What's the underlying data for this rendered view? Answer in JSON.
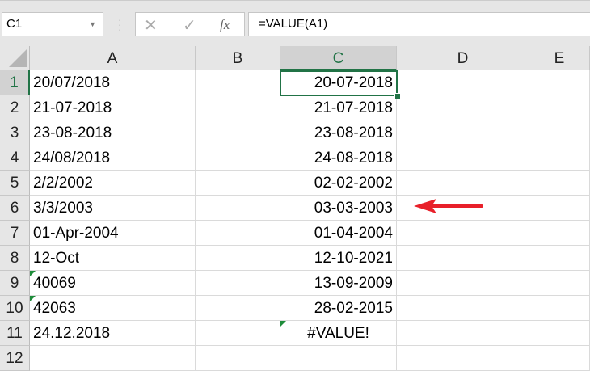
{
  "name_box": "C1",
  "formula": "=VALUE(A1)",
  "fx_label": "fx",
  "columns": [
    "A",
    "B",
    "C",
    "D",
    "E"
  ],
  "rows": [
    {
      "n": "1",
      "a": "20/07/2018",
      "c": "20-07-2018"
    },
    {
      "n": "2",
      "a": "21-07-2018",
      "c": "21-07-2018"
    },
    {
      "n": "3",
      "a": "23-08-2018",
      "c": "23-08-2018"
    },
    {
      "n": "4",
      "a": "24/08/2018",
      "c": "24-08-2018"
    },
    {
      "n": "5",
      "a": "2/2/2002",
      "c": "02-02-2002"
    },
    {
      "n": "6",
      "a": "3/3/2003",
      "c": "03-03-2003"
    },
    {
      "n": "7",
      "a": "01-Apr-2004",
      "c": "01-04-2004"
    },
    {
      "n": "8",
      "a": "12-Oct",
      "c": "12-10-2021"
    },
    {
      "n": "9",
      "a": "40069",
      "c": "13-09-2009",
      "a_warn": true
    },
    {
      "n": "10",
      "a": "42063",
      "c": "28-02-2015",
      "a_warn": true
    },
    {
      "n": "11",
      "a": "24.12.2018",
      "c": "#VALUE!",
      "c_warn": true
    },
    {
      "n": "12",
      "a": "",
      "c": ""
    }
  ],
  "colors": {
    "accent": "#217346",
    "arrow": "#e8202a"
  }
}
